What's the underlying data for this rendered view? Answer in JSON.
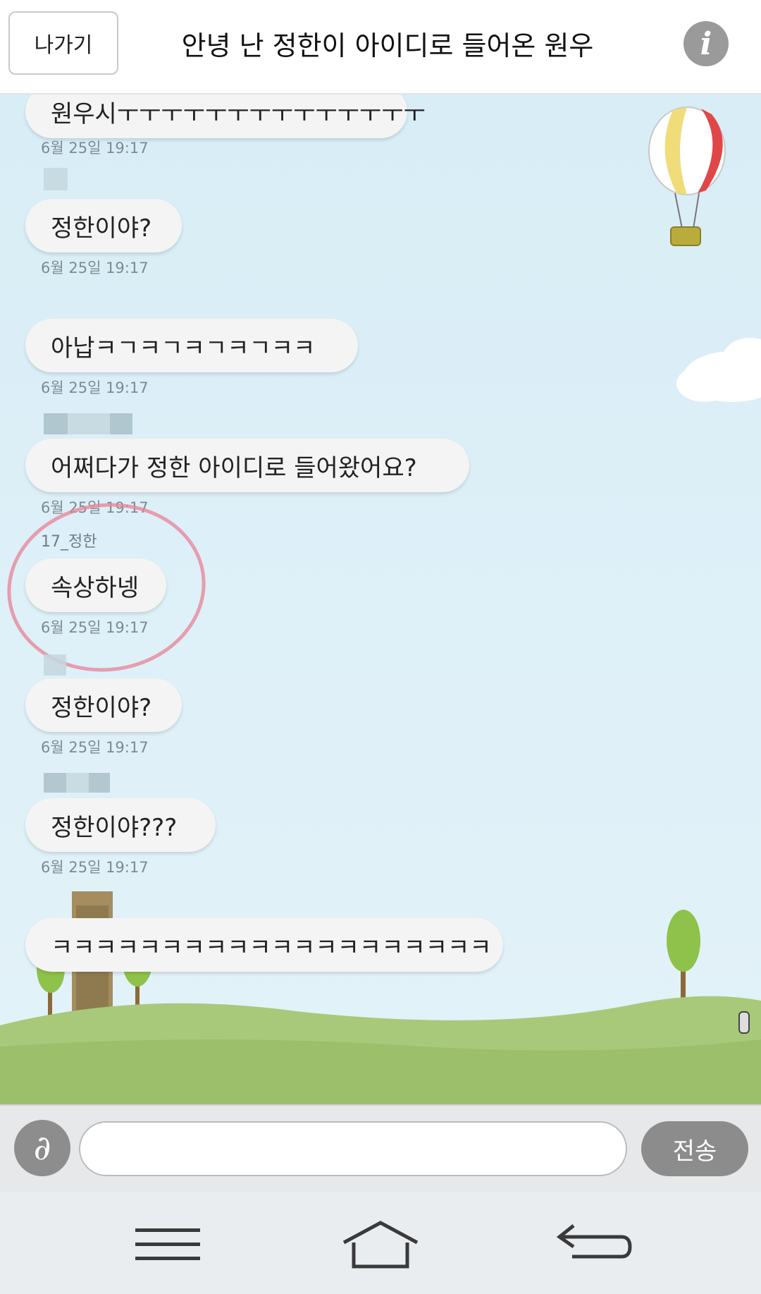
{
  "header": {
    "exit_label": "나가기",
    "title": "안녕 난 정한이 아이디로 들어온 원우",
    "info_icon": "i"
  },
  "messages": [
    {
      "text": "원우시ㅜㅜㅜㅜㅜㅜㅜㅜㅜㅜㅜㅜㅜㅜ",
      "timestamp": "6월 25일 19:17"
    },
    {
      "text": "정한이야?",
      "timestamp": "6월 25일 19:17"
    },
    {
      "text": "아납ㅋㄱㅋㄱㅋㄱㅋㄱㅋㅋ",
      "timestamp": "6월 25일 19:17"
    },
    {
      "text": "어쩌다가 정한 아이디로 들어왔어요?",
      "timestamp": "6월 25일 19:17"
    },
    {
      "sender": "17_정한",
      "text": "속상하넹",
      "timestamp": "6월 25일 19:17"
    },
    {
      "text": "정한이야?",
      "timestamp": "6월 25일 19:17"
    },
    {
      "text": "정한이야???",
      "timestamp": "6월 25일 19:17"
    },
    {
      "text": "ㅋㅋㅋㅋㅋㅋㅋㅋㅋㅋㅋㅋㅋㅋㅋㅋㅋㅋㅋㅋ"
    }
  ],
  "input": {
    "placeholder": "",
    "send_label": "전송",
    "mic_icon": "ear-icon"
  },
  "navbar": {
    "icons": [
      "menu-icon",
      "home-icon",
      "back-icon"
    ]
  },
  "colors": {
    "chat_background": "#dff0f8",
    "bubble": "#f4f4f4",
    "send_button": "#8c8c8c",
    "highlight_circle": "#e88296"
  }
}
